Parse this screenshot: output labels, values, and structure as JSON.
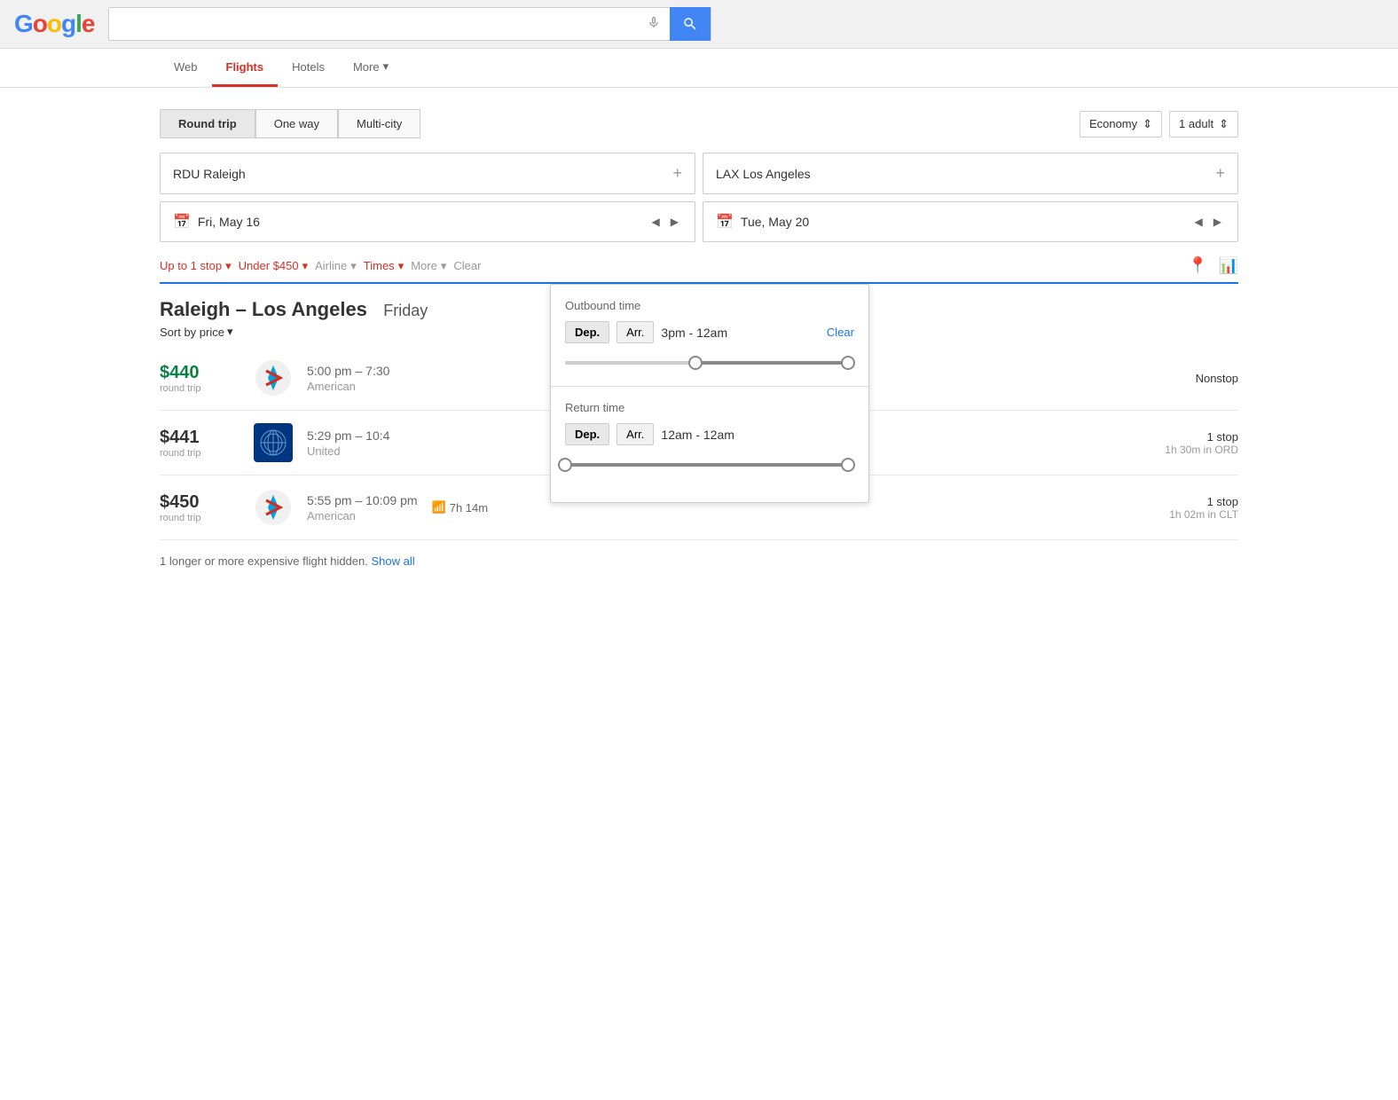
{
  "header": {
    "logo": "Google",
    "search_placeholder": ""
  },
  "nav": {
    "tabs": [
      {
        "id": "web",
        "label": "Web",
        "active": false
      },
      {
        "id": "flights",
        "label": "Flights",
        "active": true
      },
      {
        "id": "hotels",
        "label": "Hotels",
        "active": false
      },
      {
        "id": "more",
        "label": "More",
        "active": false,
        "has_arrow": true
      }
    ]
  },
  "search": {
    "trip_types": [
      {
        "id": "round-trip",
        "label": "Round trip",
        "active": true
      },
      {
        "id": "one-way",
        "label": "One way",
        "active": false
      },
      {
        "id": "multi-city",
        "label": "Multi-city",
        "active": false
      }
    ],
    "cabin": "Economy",
    "passengers": "1 adult",
    "origin": "RDU Raleigh",
    "destination": "LAX Los Angeles",
    "depart_date": "Fri, May 16",
    "return_date": "Tue, May 20"
  },
  "filters": {
    "stops": {
      "label": "Up to 1 stop",
      "active": true
    },
    "price": {
      "label": "Under $450",
      "active": true
    },
    "airline": {
      "label": "Airline",
      "active": false
    },
    "times": {
      "label": "Times",
      "active": true
    },
    "more": {
      "label": "More",
      "active": false
    },
    "clear": {
      "label": "Clear",
      "active": false
    }
  },
  "results": {
    "title": "Raleigh – Los Angeles",
    "subtitle": "Friday",
    "sort_label": "Sort by price",
    "flights": [
      {
        "price": "$440",
        "price_type": "round trip",
        "cheap": true,
        "times": "5:00 pm – 7:30",
        "airline": "American",
        "duration": "",
        "wifi": false,
        "stops": "Nonstop",
        "stop_detail": ""
      },
      {
        "price": "$441",
        "price_type": "round trip",
        "cheap": false,
        "times": "5:29 pm – 10:4",
        "airline": "United",
        "duration": "",
        "wifi": false,
        "stops": "1 stop",
        "stop_detail": "1h 30m in ORD"
      },
      {
        "price": "$450",
        "price_type": "round trip",
        "cheap": false,
        "times": "5:55 pm – 10:09 pm",
        "airline": "American",
        "duration": "7h 14m",
        "wifi": true,
        "stops": "1 stop",
        "stop_detail": "1h 02m in CLT"
      }
    ],
    "hidden_notice": "1 longer or more expensive flight hidden.",
    "show_all": "Show all"
  },
  "times_dropdown": {
    "outbound_title": "Outbound time",
    "dep_label": "Dep.",
    "arr_label": "Arr.",
    "outbound_range": "3pm - 12am",
    "outbound_clear": "Clear",
    "return_title": "Return time",
    "return_range": "12am - 12am"
  }
}
